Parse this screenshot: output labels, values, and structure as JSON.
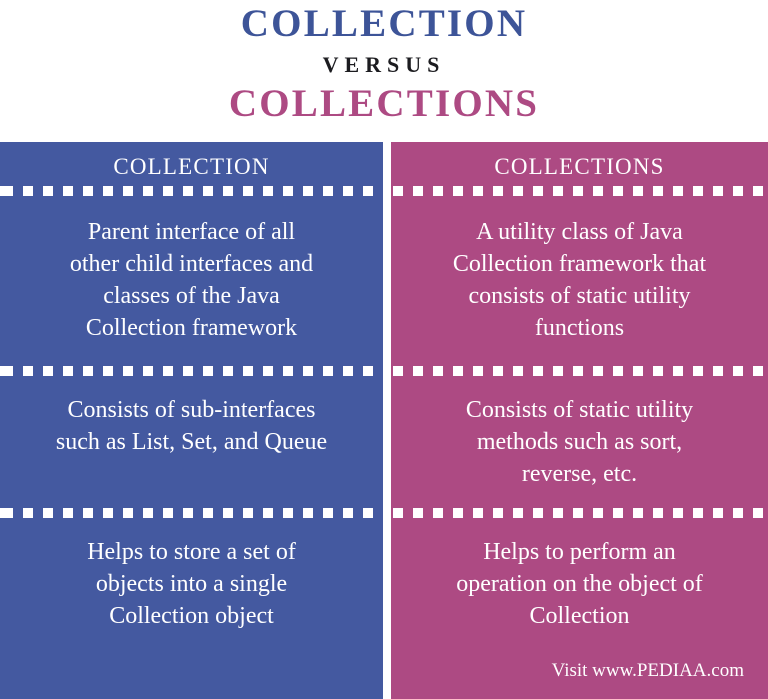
{
  "title": {
    "main": "COLLECTION",
    "versus": "VERSUS",
    "sub": "COLLECTIONS"
  },
  "colors": {
    "blue": "#4459a0",
    "title_blue": "#3d5498",
    "pink": "#ad4a83",
    "versus_text": "#1c1c20",
    "panel_text": "#ffffff",
    "background": "#ffffff"
  },
  "columns": [
    {
      "key": "collection",
      "header": "COLLECTION",
      "rows": [
        {
          "lines": [
            "Parent interface of all",
            "other child interfaces and",
            "classes of the Java",
            "Collection framework"
          ]
        },
        {
          "lines": [
            "Consists of sub-interfaces",
            "such as List, Set, and Queue"
          ]
        },
        {
          "lines": [
            "Helps to store a set of",
            "objects into a single",
            "Collection object"
          ]
        }
      ]
    },
    {
      "key": "collections",
      "header": "COLLECTIONS",
      "rows": [
        {
          "lines": [
            "A utility class of Java",
            "Collection framework that",
            "consists of static utility",
            "functions"
          ]
        },
        {
          "lines": [
            "Consists of static utility",
            "methods such as sort,",
            "reverse, etc."
          ]
        },
        {
          "lines": [
            "Helps to perform an",
            "operation on the object of",
            "Collection"
          ]
        }
      ]
    }
  ],
  "footer": {
    "credit": "Visit www.PEDIAA.com"
  }
}
